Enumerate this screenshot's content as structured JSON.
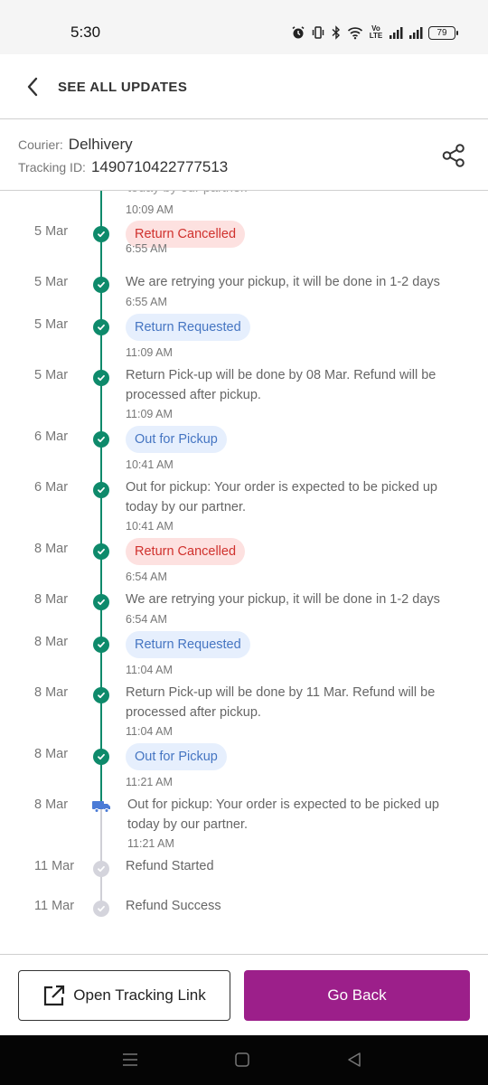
{
  "status_bar": {
    "time": "5:30",
    "volte_label": "Vo\nLTE",
    "battery": "79"
  },
  "header": {
    "title": "SEE ALL UPDATES"
  },
  "info": {
    "courier_label": "Courier:",
    "courier_value": "Delhivery",
    "tracking_label": "Tracking ID:",
    "tracking_value": "1490710422777513"
  },
  "timeline": {
    "partial_message": "today by our partner.",
    "partial_time": "10:09 AM",
    "events": [
      {
        "date": "5 Mar",
        "type": "pill",
        "style": "red",
        "text": "Return Cancelled",
        "time": "6:55 AM"
      },
      {
        "date": "5 Mar",
        "type": "text",
        "text": "We are retrying your pickup, it will be done in 1-2 days",
        "time": "6:55 AM"
      },
      {
        "date": "5 Mar",
        "type": "pill",
        "style": "blue",
        "text": "Return Requested",
        "time": "11:09 AM"
      },
      {
        "date": "5 Mar",
        "type": "text",
        "text": "Return Pick-up will be done by 08 Mar. Refund will be processed after pickup.",
        "time": "11:09 AM"
      },
      {
        "date": "6 Mar",
        "type": "pill",
        "style": "blue",
        "text": "Out for Pickup",
        "time": "10:41 AM"
      },
      {
        "date": "6 Mar",
        "type": "text",
        "text": "Out for pickup: Your order is expected to be picked up today by our partner.",
        "time": "10:41 AM"
      },
      {
        "date": "8 Mar",
        "type": "pill",
        "style": "red",
        "text": "Return Cancelled",
        "time": "6:54 AM"
      },
      {
        "date": "8 Mar",
        "type": "text",
        "text": "We are retrying your pickup, it will be done in 1-2 days",
        "time": "6:54 AM"
      },
      {
        "date": "8 Mar",
        "type": "pill",
        "style": "blue",
        "text": "Return Requested",
        "time": "11:04 AM"
      },
      {
        "date": "8 Mar",
        "type": "text",
        "text": "Return Pick-up will be done by 11 Mar. Refund will be processed after pickup.",
        "time": "11:04 AM"
      },
      {
        "date": "8 Mar",
        "type": "pill",
        "style": "blue",
        "text": "Out for Pickup",
        "time": "11:21 AM"
      },
      {
        "date": "8 Mar",
        "type": "current",
        "text": "Out for pickup: Your order is expected to be picked up today by our partner.",
        "time": "11:21 AM"
      },
      {
        "date": "11 Mar",
        "type": "pending",
        "text": "Refund Started",
        "time": ""
      },
      {
        "date": "11 Mar",
        "type": "pending",
        "text": "Refund Success",
        "time": ""
      }
    ]
  },
  "footer": {
    "open_link_label": "Open Tracking Link",
    "go_back_label": "Go Back"
  },
  "colors": {
    "accent": "#9c1f8a",
    "success": "#0e8a6b",
    "cancel_bg": "#fde1e0",
    "cancel_text": "#d0312d",
    "info_bg": "#e6effd",
    "info_text": "#4575c2",
    "truck": "#4a7bd6"
  },
  "icons": {
    "header": [
      "chevron-left-icon",
      "share-icon"
    ],
    "timeline": [
      "check-circle-icon",
      "truck-icon"
    ],
    "footer": [
      "external-link-icon"
    ],
    "status_bar": [
      "alarm-icon",
      "vibrate-icon",
      "bluetooth-icon",
      "wifi-icon",
      "signal-icon"
    ]
  }
}
